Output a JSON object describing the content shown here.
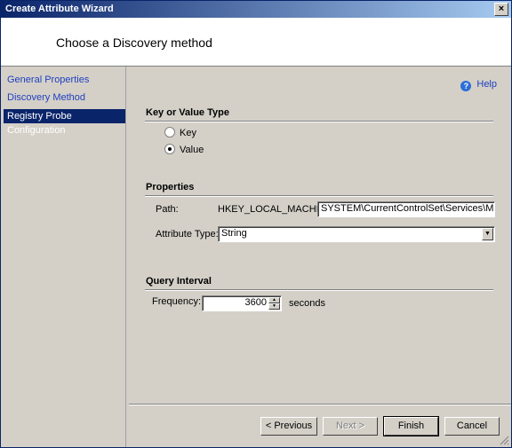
{
  "window": {
    "title": "Create Attribute Wizard",
    "close_glyph": "×"
  },
  "header": {
    "title": "Choose a Discovery method"
  },
  "sidebar": {
    "items": [
      {
        "label": "General Properties",
        "active": false
      },
      {
        "label": "Discovery Method",
        "active": false
      },
      {
        "label": "Registry Probe Configuration",
        "active": true
      }
    ]
  },
  "help": {
    "label": "Help",
    "icon": "help-icon"
  },
  "key_or_value": {
    "heading": "Key or Value Type",
    "options": [
      {
        "label": "Key",
        "checked": false
      },
      {
        "label": "Value",
        "checked": true
      }
    ]
  },
  "properties": {
    "heading": "Properties",
    "path_label": "Path:",
    "path_prefix": "HKEY_LOCAL_MACHINE\\",
    "path_value": "SYSTEM\\CurrentControlSet\\Services\\MSSQLS",
    "attr_type_label": "Attribute Type:",
    "attr_type_value": "String"
  },
  "query_interval": {
    "heading": "Query Interval",
    "frequency_label": "Frequency:",
    "frequency_value": "3600",
    "frequency_unit": "seconds"
  },
  "buttons": {
    "previous": "< Previous",
    "next": "Next >",
    "finish": "Finish",
    "cancel": "Cancel"
  },
  "colors": {
    "title_start": "#0a246a",
    "title_end": "#a6caf0",
    "nav_link": "#1f3fbf",
    "selection": "#0a246a"
  }
}
